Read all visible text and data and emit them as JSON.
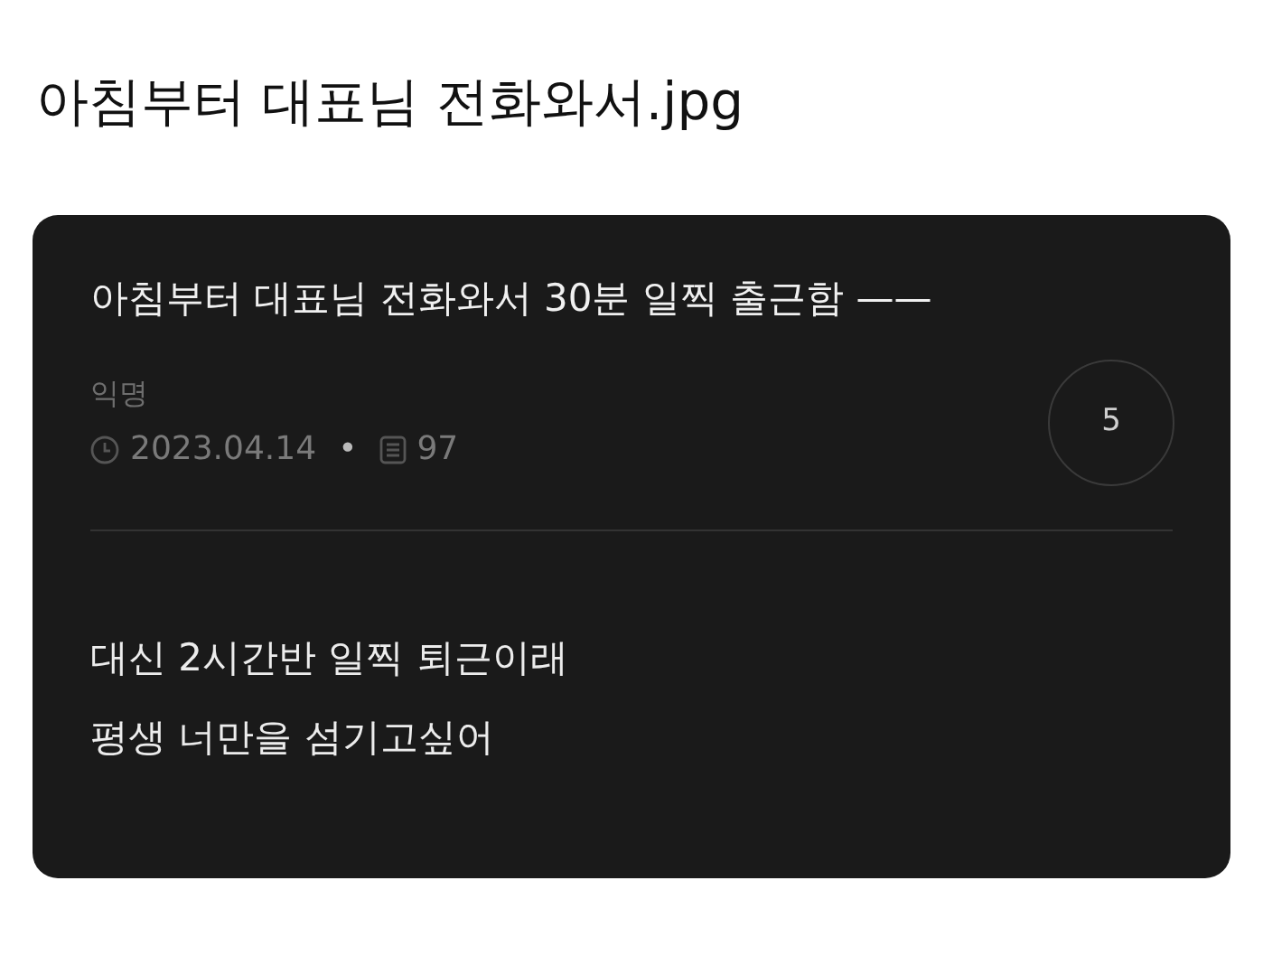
{
  "page_title": "아침부터 대표님 전화와서.jpg",
  "post": {
    "title": "아침부터 대표님 전화와서 30분 일찍 출근함 ——",
    "author": "익명",
    "date": "2023.04.14",
    "separator": "•",
    "views": "97",
    "comment_count": "5",
    "body": [
      "대신 2시간반 일찍 퇴근이래",
      "평생 너만을 섬기고싶어"
    ]
  }
}
